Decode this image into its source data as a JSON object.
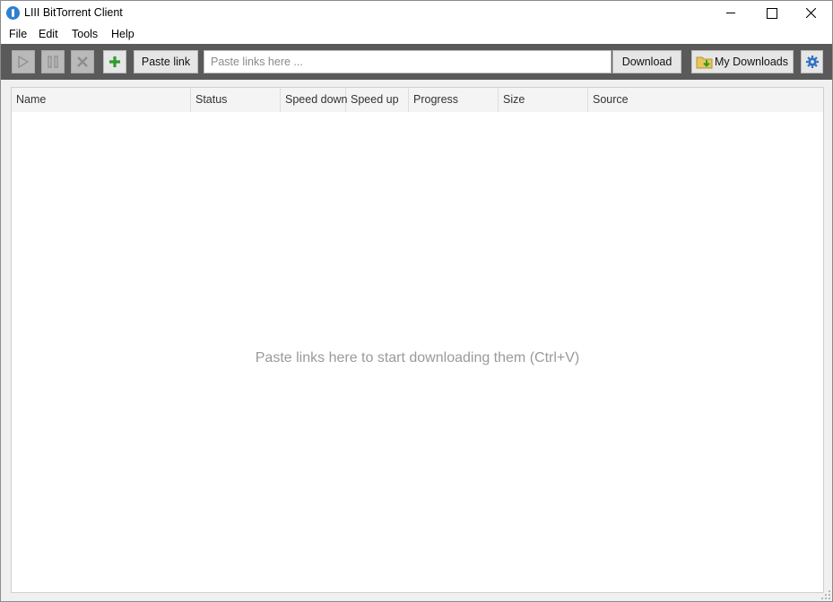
{
  "window": {
    "title": "LIII BitTorrent Client"
  },
  "menu": [
    {
      "label": "File"
    },
    {
      "label": "Edit"
    },
    {
      "label": "Tools"
    },
    {
      "label": "Help"
    }
  ],
  "toolbar": {
    "play_icon": "play-icon",
    "pause_icon": "pause-icon",
    "stop_icon": "stop-icon",
    "add_icon": "plus-icon",
    "paste_label": "Paste link",
    "link_placeholder": "Paste links here ...",
    "link_value": "",
    "download_label": "Download",
    "my_downloads_label": "My Downloads",
    "settings_icon": "gear-icon"
  },
  "table": {
    "columns": [
      "Name",
      "Status",
      "Speed down",
      "Speed up",
      "Progress",
      "Size",
      "Source"
    ],
    "rows": [],
    "empty_message": "Paste links here to start downloading them (Ctrl+V)"
  },
  "colors": {
    "toolbar_bg": "#5a5a5a",
    "add_green": "#2e9b2e",
    "settings_blue": "#2d6fc4"
  }
}
